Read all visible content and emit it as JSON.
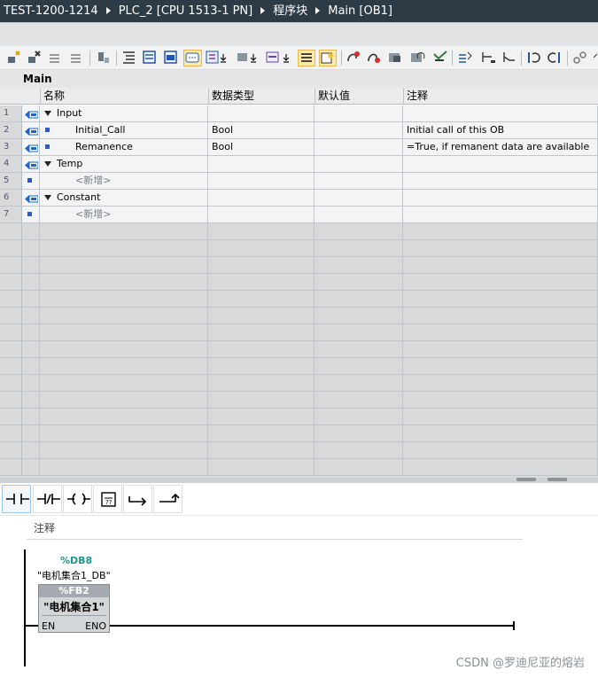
{
  "breadcrumb": [
    "TEST-1200-1214",
    "PLC_2 [CPU 1513-1 PN]",
    "程序块",
    "Main [OB1]"
  ],
  "block_title": "Main",
  "columns": {
    "name": "名称",
    "datatype": "数据类型",
    "default": "默认值",
    "comment": "注释"
  },
  "rows": [
    {
      "n": "1",
      "name": "Input",
      "type": "",
      "comment": "",
      "kind": "section",
      "icon": "io"
    },
    {
      "n": "2",
      "name": "Initial_Call",
      "type": "Bool",
      "comment": "Initial call of this OB",
      "kind": "var",
      "icon": "io"
    },
    {
      "n": "3",
      "name": "Remanence",
      "type": "Bool",
      "comment": "=True, if remanent data are available",
      "kind": "var",
      "icon": "io"
    },
    {
      "n": "4",
      "name": "Temp",
      "type": "",
      "comment": "",
      "kind": "section",
      "icon": "io"
    },
    {
      "n": "5",
      "name": "<新增>",
      "type": "",
      "comment": "",
      "kind": "add",
      "icon": ""
    },
    {
      "n": "6",
      "name": "Constant",
      "type": "",
      "comment": "",
      "kind": "section",
      "icon": "io"
    },
    {
      "n": "7",
      "name": "<新增>",
      "type": "",
      "comment": "",
      "kind": "add",
      "icon": ""
    }
  ],
  "network": {
    "comment": "注释",
    "db_address": "%DB8",
    "db_name": "\"电机集合1_DB\"",
    "fb_address": "%FB2",
    "fb_name": "\"电机集合1\"",
    "en": "EN",
    "eno": "ENO"
  },
  "watermark": "CSDN @罗迪尼亚的熔岩",
  "colors": {
    "io_arrow": "#1b66c9",
    "var_square": "#2a57d8",
    "db_address": "#1a9a91",
    "header_bar": "#2d3b46"
  }
}
